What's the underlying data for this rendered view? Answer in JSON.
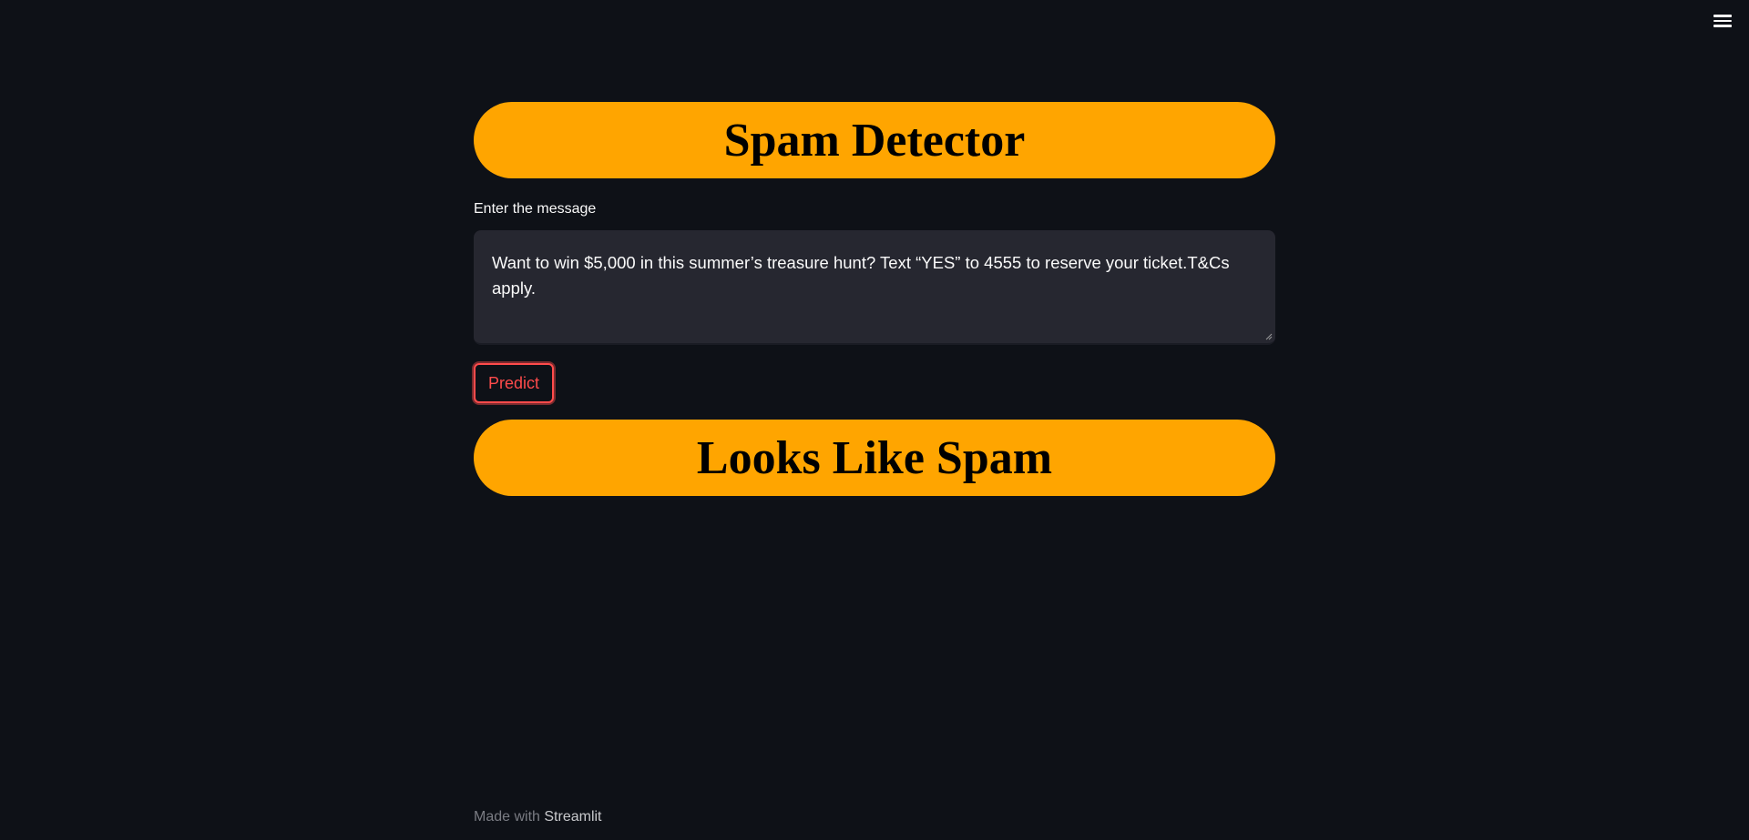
{
  "app": {
    "menu_icon": "hamburger-menu-icon"
  },
  "header": {
    "title": "Spam Detector"
  },
  "input": {
    "label": "Enter the message",
    "value": "Want to win $5,000 in this summer’s treasure hunt? Text “YES” to 4555 to reserve your ticket.T&Cs apply."
  },
  "actions": {
    "predict_label": "Predict"
  },
  "result": {
    "text": "Looks Like Spam"
  },
  "footer": {
    "prefix": "Made with",
    "brand": "Streamlit"
  },
  "colors": {
    "background": "#0e1117",
    "banner": "#ffa500",
    "accent": "#ff4b4b",
    "input_bg": "#262730"
  }
}
